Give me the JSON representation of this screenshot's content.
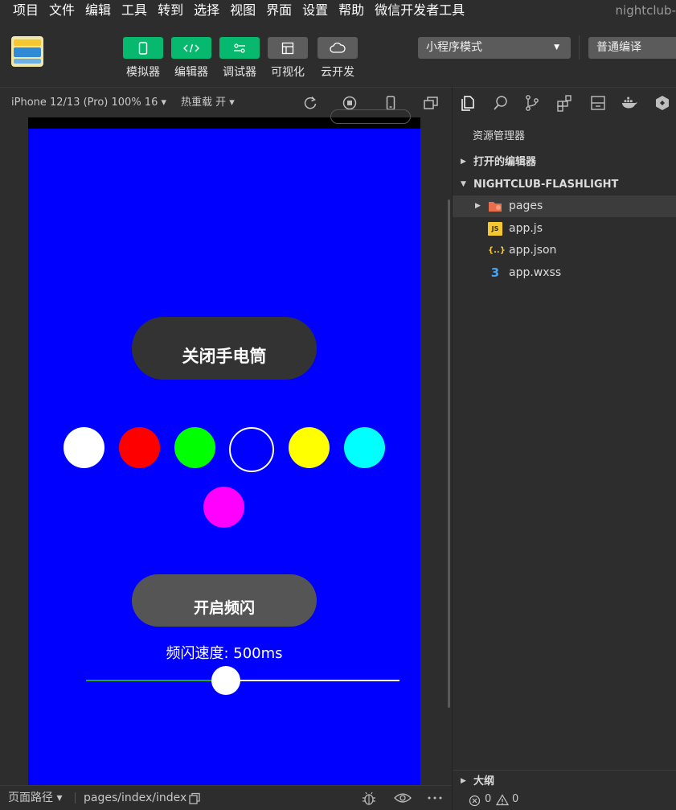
{
  "menu": [
    "项目",
    "文件",
    "编辑",
    "工具",
    "转到",
    "选择",
    "视图",
    "界面",
    "设置",
    "帮助",
    "微信开发者工具"
  ],
  "app_title": "nightclub-",
  "toolbar": {
    "tools": [
      {
        "label": "模拟器",
        "icon": "phone-icon",
        "style": "green"
      },
      {
        "label": "编辑器",
        "icon": "code-icon",
        "style": "green"
      },
      {
        "label": "调试器",
        "icon": "sliders-icon",
        "style": "green"
      },
      {
        "label": "可视化",
        "icon": "layout-icon",
        "style": "gray"
      },
      {
        "label": "云开发",
        "icon": "cloud-icon",
        "style": "gray"
      }
    ],
    "mode": "小程序模式",
    "compile": "普通编译"
  },
  "simulator": {
    "device_info": "iPhone 12/13 (Pro) 100% 16 ▾",
    "hot_reload": "热重载 开 ▾"
  },
  "phone": {
    "background": "#0000ff",
    "torch_button": "关闭手电筒",
    "strobe_button": "开启频闪",
    "speed_label": "频闪速度: 500ms",
    "slider_value": 0.445,
    "colors": [
      "#ffffff",
      "#ff0000",
      "#00ff00",
      "#0000ff",
      "#ffff00",
      "#00ffff",
      "#ff00ff"
    ],
    "selected_color": "#0000ff"
  },
  "footer": {
    "page_path_label": "页面路径 ▾",
    "page_path": "pages/index/index"
  },
  "explorer": {
    "title": "资源管理器",
    "open_editors": "打开的编辑器",
    "project": "NIGHTCLUB-FLASHLIGHT",
    "files": [
      {
        "name": "pages",
        "icon": "folder-icon",
        "color": "#e86f4c"
      },
      {
        "name": "app.js",
        "icon": "js-file-icon",
        "color": "#f5c730"
      },
      {
        "name": "app.json",
        "icon": "json-file-icon",
        "color": "#f5c730"
      },
      {
        "name": "app.wxss",
        "icon": "css-file-icon",
        "color": "#42a5f5"
      }
    ],
    "outline": "大纲"
  },
  "status": {
    "errors": "0",
    "warnings": "0"
  }
}
